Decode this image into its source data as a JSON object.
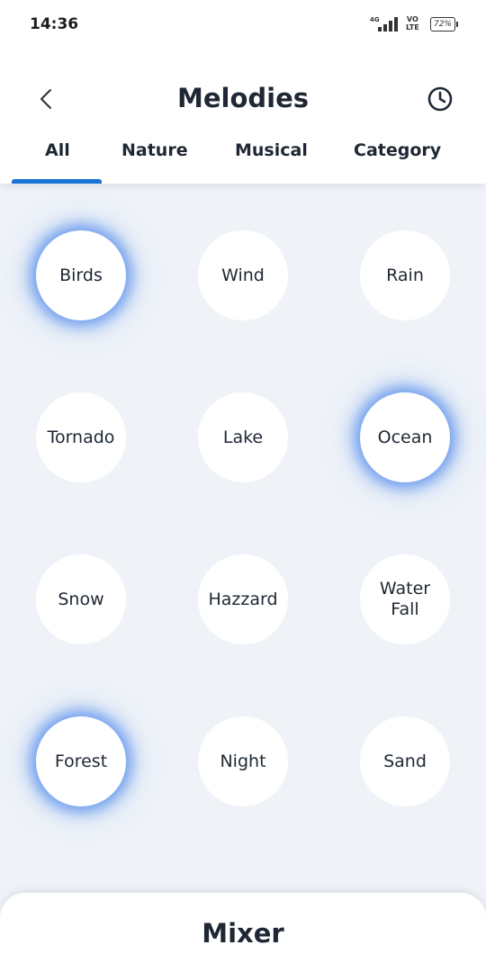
{
  "status_bar": {
    "time": "14:36",
    "network": "4G",
    "volte_top": "VO",
    "volte_bottom": "LTE",
    "battery": "72%"
  },
  "header": {
    "title": "Melodies",
    "back_icon": "chevron-left-icon",
    "history_icon": "clock-icon"
  },
  "tabs": [
    {
      "label": "All",
      "selected": true
    },
    {
      "label": "Nature",
      "selected": false
    },
    {
      "label": "Musical",
      "selected": false
    },
    {
      "label": "Category",
      "selected": false
    }
  ],
  "sounds": [
    {
      "label": "Birds",
      "active": true
    },
    {
      "label": "Wind",
      "active": false
    },
    {
      "label": "Rain",
      "active": false
    },
    {
      "label": "Tornado",
      "active": false
    },
    {
      "label": "Lake",
      "active": false
    },
    {
      "label": "Ocean",
      "active": true
    },
    {
      "label": "Snow",
      "active": false
    },
    {
      "label": "Hazzard",
      "active": false
    },
    {
      "label": "Water Fall",
      "active": false
    },
    {
      "label": "Forest",
      "active": true
    },
    {
      "label": "Night",
      "active": false
    },
    {
      "label": "Sand",
      "active": false
    }
  ],
  "mixer": {
    "title": "Mixer"
  },
  "colors": {
    "accent": "#1a74d6",
    "glow": "#4682eb",
    "background": "#eff3f8",
    "text": "#1e2733"
  }
}
